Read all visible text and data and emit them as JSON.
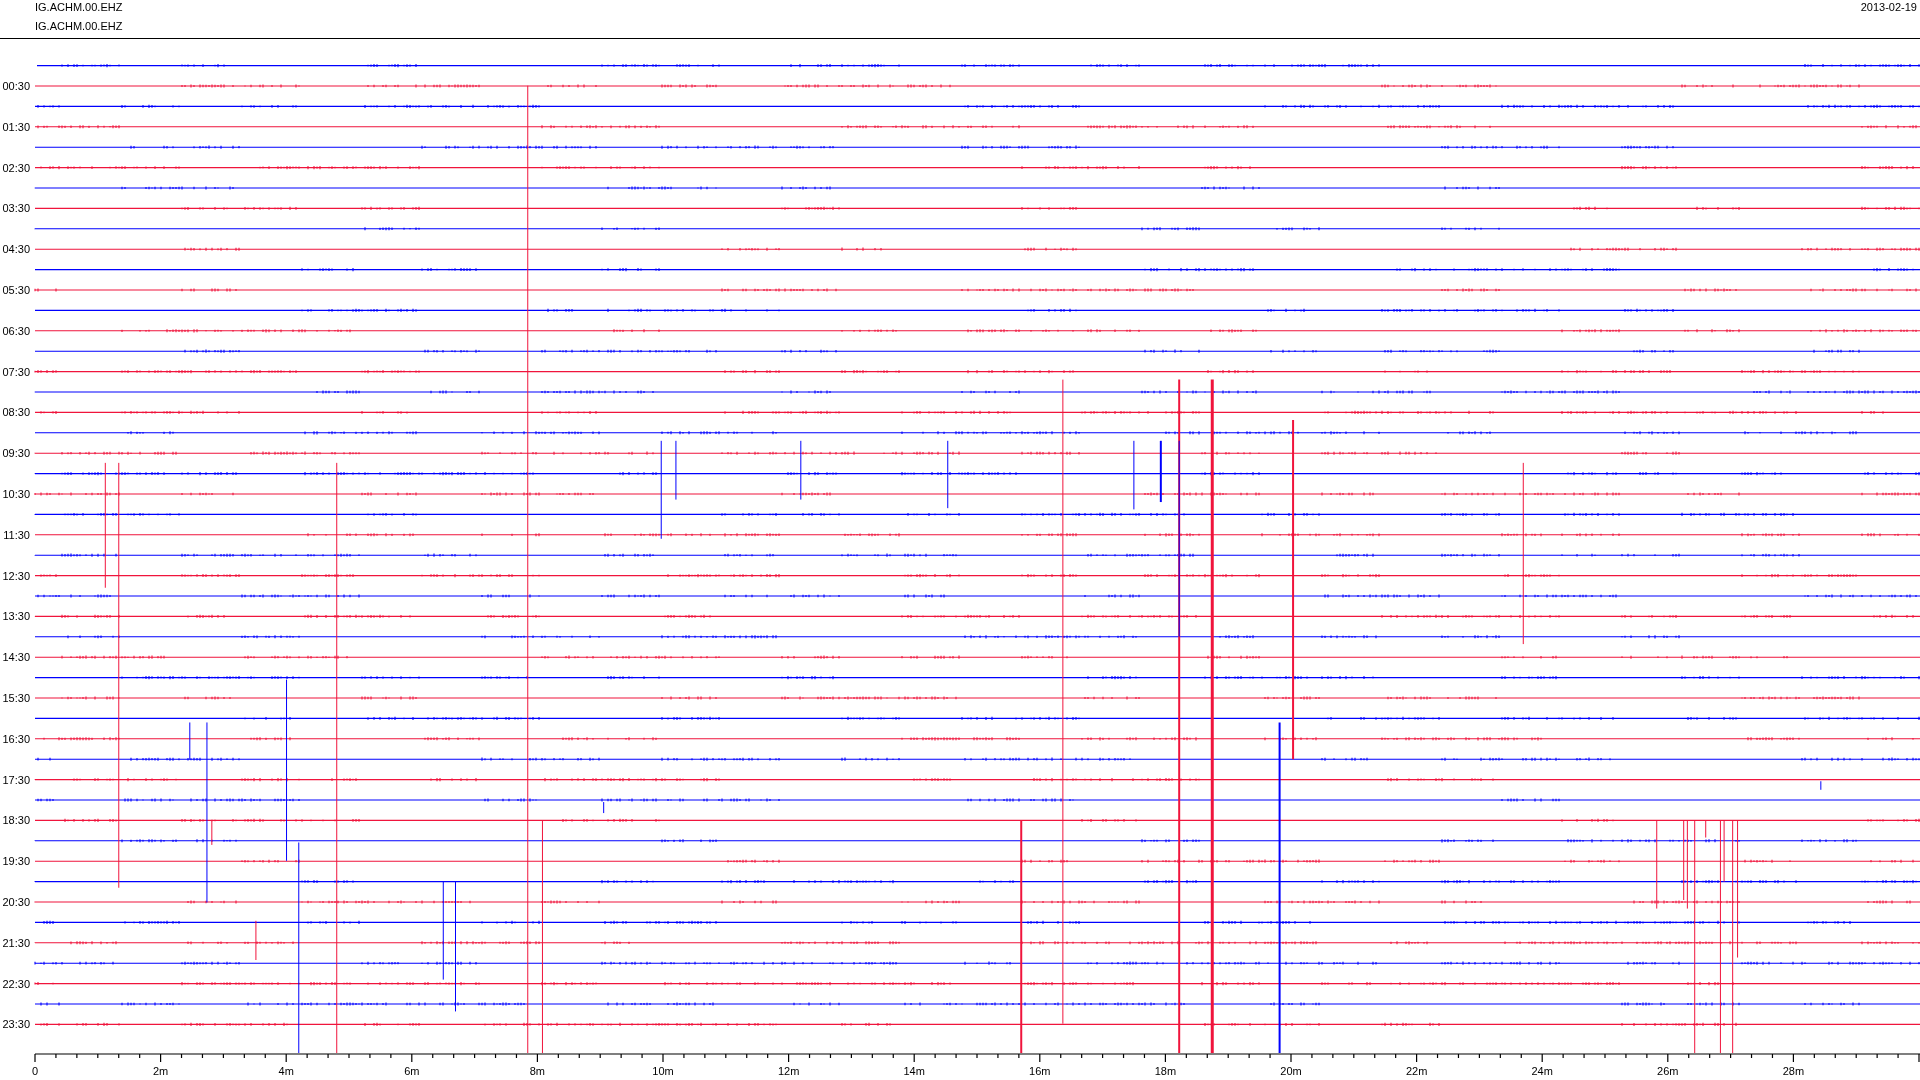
{
  "header": {
    "trace_ids": [
      "IG.ACHM.00.EHZ",
      "IG.ACHM.00.EHZ"
    ],
    "date": "2013-02-19"
  },
  "plot": {
    "row_labels": [
      "00:30",
      "01:30",
      "02:30",
      "03:30",
      "04:30",
      "05:30",
      "06:30",
      "07:30",
      "08:30",
      "09:30",
      "10:30",
      "11:30",
      "12:30",
      "13:30",
      "14:30",
      "15:30",
      "16:30",
      "17:30",
      "18:30",
      "19:30",
      "20:30",
      "21:30",
      "22:30",
      "23:30"
    ],
    "x_tick_labels": [
      "0",
      "2m",
      "4m",
      "6m",
      "8m",
      "10m",
      "12m",
      "14m",
      "16m",
      "18m",
      "20m",
      "22m",
      "24m",
      "26m",
      "28m"
    ]
  }
}
